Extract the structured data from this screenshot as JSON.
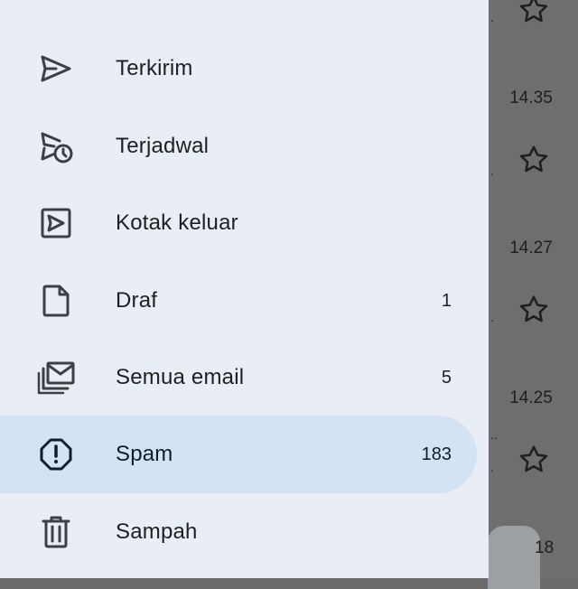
{
  "background": {
    "times": [
      "14.35",
      "14.27",
      "14.25",
      "18"
    ]
  },
  "drawer": {
    "items": [
      {
        "label": "Terkirim",
        "count": "",
        "icon": "send-icon"
      },
      {
        "label": "Terjadwal",
        "count": "",
        "icon": "scheduled-send-icon"
      },
      {
        "label": "Kotak keluar",
        "count": "",
        "icon": "outbox-icon"
      },
      {
        "label": "Draf",
        "count": "1",
        "icon": "draft-file-icon"
      },
      {
        "label": "Semua email",
        "count": "5",
        "icon": "all-mail-icon"
      },
      {
        "label": "Spam",
        "count": "183",
        "icon": "spam-report-icon",
        "active": true
      },
      {
        "label": "Sampah",
        "count": "",
        "icon": "trash-icon"
      }
    ]
  },
  "colors": {
    "drawer_bg": "#e9eef6",
    "active_bg": "#d3e3f3",
    "scrim": "#6e6e6e"
  }
}
